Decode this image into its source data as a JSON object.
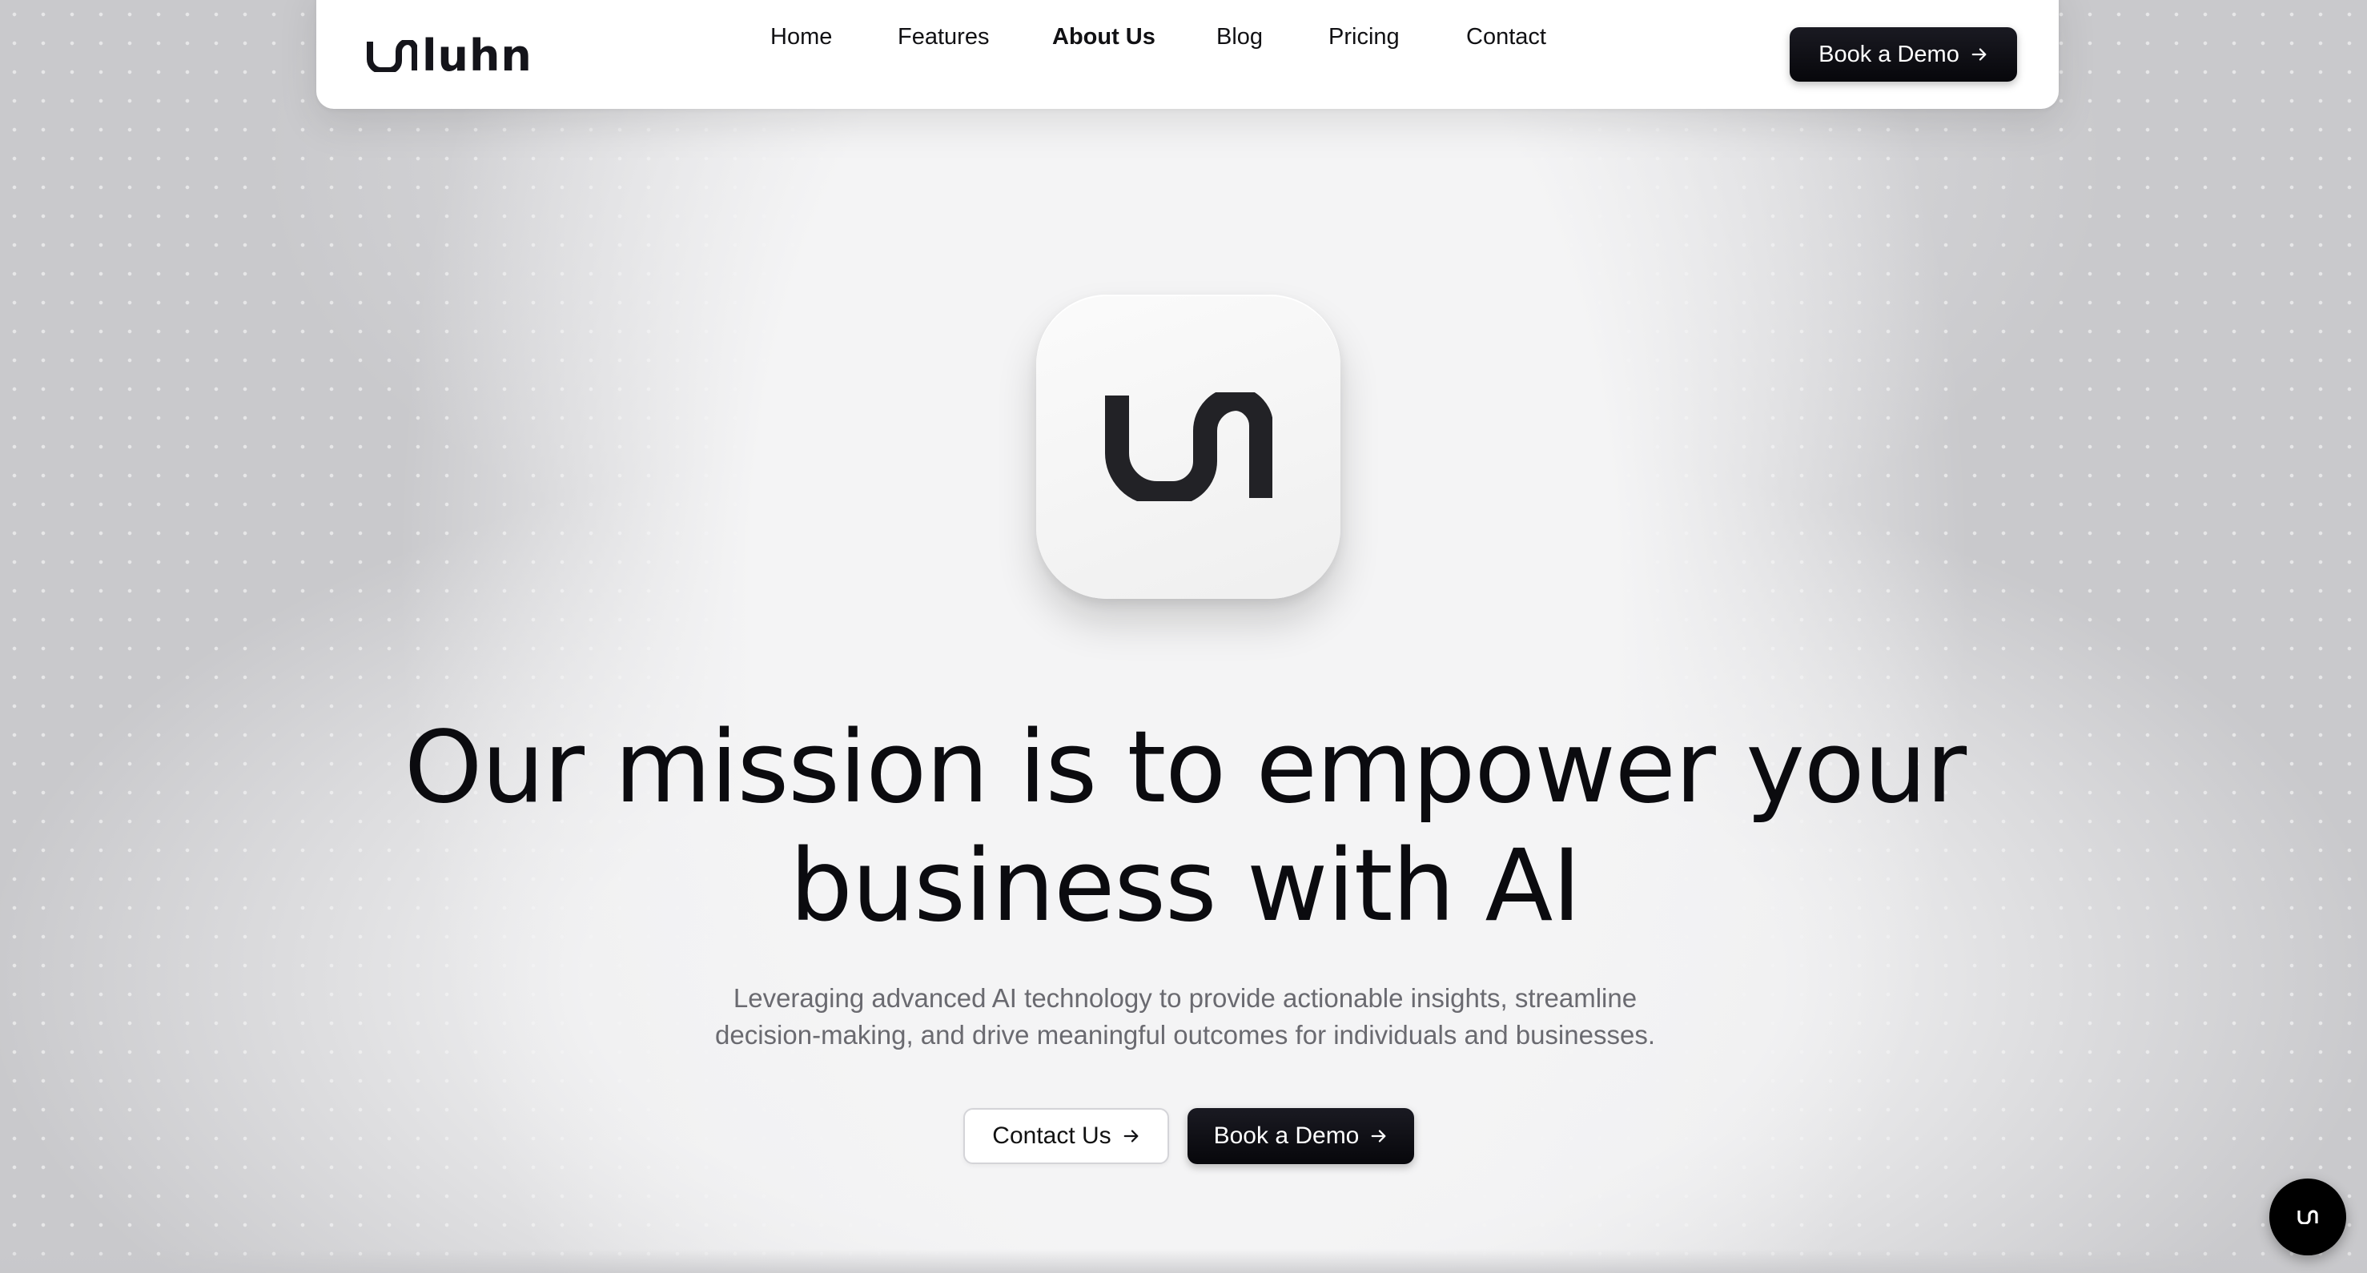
{
  "brand": {
    "name": "luhn"
  },
  "nav": {
    "links": [
      {
        "label": "Home"
      },
      {
        "label": "Features"
      },
      {
        "label": "About Us",
        "active": true
      },
      {
        "label": "Blog"
      },
      {
        "label": "Pricing"
      },
      {
        "label": "Contact"
      }
    ],
    "cta_label": "Book a Demo"
  },
  "hero": {
    "headline_line1": "Our mission is to empower your",
    "headline_line2": "business with AI",
    "subtext_line1": "Leveraging advanced AI technology to provide actionable insights, streamline",
    "subtext_line2": "decision-making, and drive meaningful outcomes for individuals and businesses.",
    "primary_button": "Contact Us",
    "secondary_button": "Book a Demo"
  },
  "icons": {
    "logo": "luhn-logo-mark-icon",
    "arrow": "arrow-right-icon",
    "chat": "chat-launcher-icon"
  },
  "colors": {
    "accent_dark": "#0b0b10",
    "background": "#f2f2f3",
    "muted_text": "#6a6a70"
  }
}
